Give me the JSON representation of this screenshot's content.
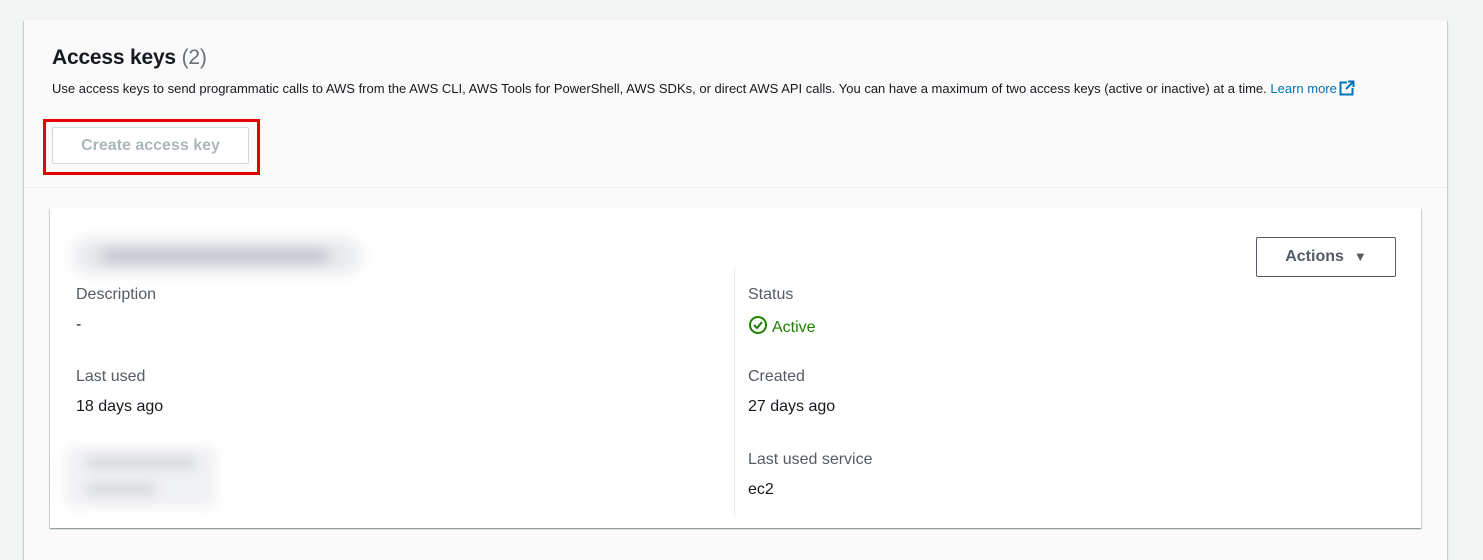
{
  "header": {
    "title": "Access keys",
    "count": "(2)",
    "description": "Use access keys to send programmatic calls to AWS from the AWS CLI, AWS Tools for PowerShell, AWS SDKs, or direct AWS API calls. You can have a maximum of two access keys (active or inactive) at a time.",
    "learn_more": "Learn more",
    "create_button": "Create access key"
  },
  "key": {
    "actions_label": "Actions",
    "description_label": "Description",
    "description_value": "-",
    "status_label": "Status",
    "status_value": "Active",
    "last_used_label": "Last used",
    "last_used_value": "18 days ago",
    "created_label": "Created",
    "created_value": "27 days ago",
    "last_used_service_label": "Last used service",
    "last_used_service_value": "ec2"
  },
  "colors": {
    "link": "#0073bb",
    "active": "#1d8102",
    "highlight": "#e60000"
  },
  "icons": {
    "external_link": "external-link-icon",
    "status": "status-positive-icon",
    "caret": "caret-down-icon"
  }
}
